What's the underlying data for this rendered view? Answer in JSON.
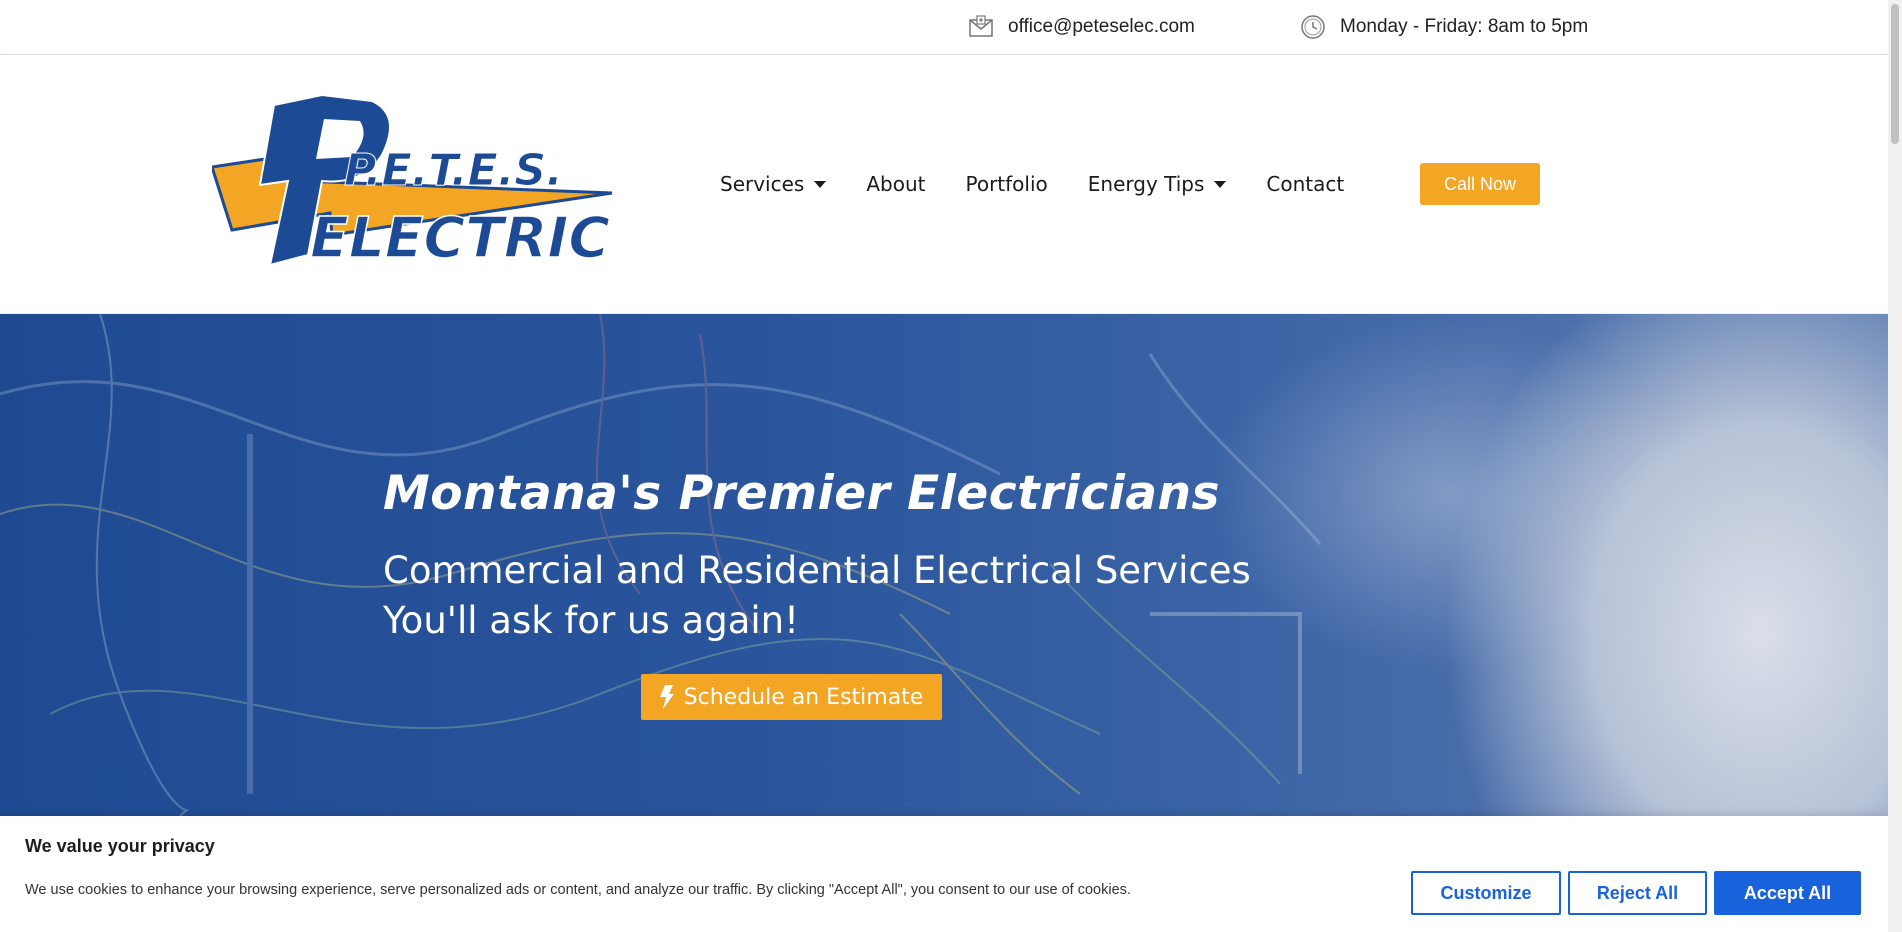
{
  "topbar": {
    "email": "office@peteselec.com",
    "email_icon": "envelope-icon",
    "hours": "Monday - Friday: 8am to 5pm",
    "hours_icon": "clock-icon"
  },
  "logo": {
    "line1": "P.E.T.E.S.",
    "line2": "ELECTRIC"
  },
  "nav": {
    "services": "Services",
    "about": "About",
    "portfolio": "Portfolio",
    "energy_tips": "Energy Tips",
    "contact": "Contact",
    "call_now": "Call Now"
  },
  "hero": {
    "title": "Montana's Premier Electricians",
    "subtitle_line1": "Commercial and Residential Electrical Services",
    "subtitle_line2": "You'll ask for us again!",
    "cta": "Schedule an Estimate",
    "cta_icon": "bolt-icon"
  },
  "cookie": {
    "title": "We value your privacy",
    "text": "We use cookies to enhance your browsing experience, serve personalized ads or content, and analyze our traffic. By clicking \"Accept All\", you consent to our use of cookies.",
    "customize": "Customize",
    "reject": "Reject All",
    "accept": "Accept All"
  },
  "colors": {
    "accent": "#f2a624",
    "brand_blue": "#1c4a94",
    "cookie_blue": "#1863dc"
  }
}
